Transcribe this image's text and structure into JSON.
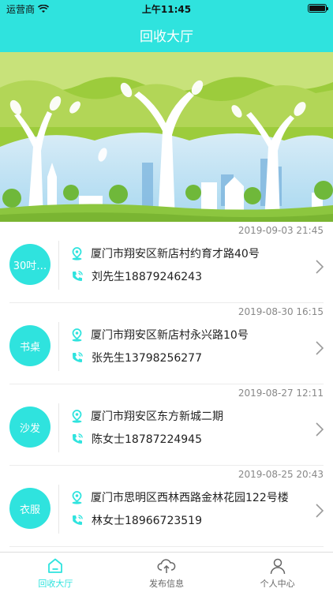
{
  "status": {
    "carrier": "运营商",
    "time": "上午11:45"
  },
  "nav": {
    "title": "回收大厅"
  },
  "colors": {
    "accent": "#2FE3DE"
  },
  "orders": [
    {
      "category": "30吋…",
      "date": "2019-09-03 21:45",
      "address": "厦门市翔安区新店村约育才路40号",
      "contact": "刘先生18879246243"
    },
    {
      "category": "书桌",
      "date": "2019-08-30 16:15",
      "address": "厦门市翔安区新店村永兴路10号",
      "contact": "张先生13798256277"
    },
    {
      "category": "沙发",
      "date": "2019-08-27 12:11",
      "address": "厦门市翔安区东方新城二期",
      "contact": "陈女士18787224945"
    },
    {
      "category": "衣服",
      "date": "2019-08-25 20:43",
      "address": "厦门市思明区西林西路金林花园122号楼",
      "contact": "林女士18966723519"
    }
  ],
  "tabs": [
    {
      "label": "回收大厅",
      "icon": "home-icon",
      "active": true
    },
    {
      "label": "发布信息",
      "icon": "cloud-upload-icon",
      "active": false
    },
    {
      "label": "个人中心",
      "icon": "person-icon",
      "active": false
    }
  ]
}
